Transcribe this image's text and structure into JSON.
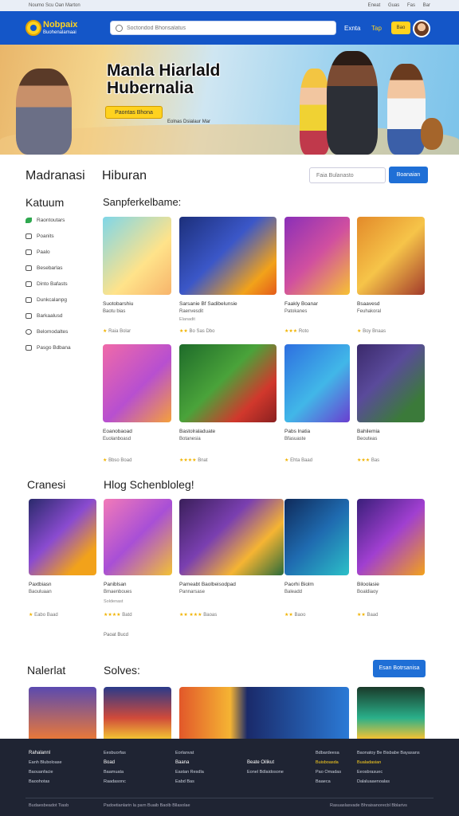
{
  "topbar": {
    "left": "Noumo Scu Oan Marton",
    "links": [
      "Eneat",
      "Guas",
      "Fas",
      "Bar"
    ]
  },
  "header": {
    "logo_title": "Nobpaix",
    "logo_sub": "Buohenalamaai",
    "search_placeholder": "Soctondod Bhonsalatus",
    "nav_link": "Exnta",
    "nav_link_active": "Tap",
    "button": "Bao"
  },
  "hero": {
    "title_line1": "Manla Hiarlald",
    "title_line2": "Hubernalia",
    "cta": "Paontas Bhona",
    "sub": "Eolnas Dsialaur Mar"
  },
  "filter_bar": {
    "left_title": "Madranasi",
    "title": "Hiburan",
    "input_placeholder": "Faia Bulanasto",
    "button": "Boanaian"
  },
  "sidebar": {
    "title": "Katuum",
    "items": [
      "Raontoutars",
      "Poanits",
      "Paalo",
      "Besebarlas",
      "Dinto Bafasts",
      "Dunkcalanpg",
      "Barkaalusd",
      "Belomodaltes",
      "Pasgo Bdbana"
    ]
  },
  "section1": {
    "title": "Sanpferkelbame:",
    "cards": [
      {
        "t1": "Suotobarshiu",
        "t2": "Baotu bias",
        "t3": "",
        "rate": "Raia Bolar",
        "stars": "★"
      },
      {
        "t1": "Sarsanie Bf Sadibelunsie",
        "t2": "Raenvesdit",
        "t3": "Elanadit",
        "rate": "Bo Sas Dbo",
        "stars": "★★"
      },
      {
        "t1": "Faakly Boanar",
        "t2": "Patokanes",
        "t3": "",
        "rate": "Roto",
        "stars": "★★★"
      },
      {
        "t1": "Bsaavesd",
        "t2": "Feuhakoral",
        "t3": "",
        "rate": "Boy Bnaas",
        "stars": "★"
      },
      {
        "t1": "Eoanobaoad",
        "t2": "Euolanboasd",
        "t3": "",
        "rate": "Bbso Boad",
        "stars": "★"
      },
      {
        "t1": "Bastolraladuate",
        "t2": "Botanesia",
        "t3": "",
        "rate": "Bnat",
        "stars": "★★★★"
      },
      {
        "t1": "Pabs lnatia",
        "t2": "Bfasuaste",
        "t3": "",
        "rate": "Ehta Baad",
        "stars": "★"
      },
      {
        "t1": "Bahilemia",
        "t2": "Beouteas",
        "t3": "",
        "rate": "Bas",
        "stars": "★★★"
      }
    ]
  },
  "section2": {
    "left_title": "Cranesi",
    "title": "Hlog Schenbloleg!",
    "cards": [
      {
        "t1": "Paxtbiasn",
        "t2": "Baouluaan",
        "t3": "",
        "rate": "Eabo Baad",
        "stars": "★"
      },
      {
        "t1": "Paniblsan",
        "t2": "Bmaenboues",
        "t3": "Soldenast",
        "rate": "Batd",
        "stars": "★★★★"
      },
      {
        "t1": "Pameabt Baolbeisodpad",
        "t2": "Pannarsase",
        "t3": "",
        "rate": "Baoas",
        "stars": "★★ ★★★"
      },
      {
        "t1": "Paorhi Biolm",
        "t2": "Baleadd",
        "t3": "",
        "rate": "Baoo",
        "stars": "★★"
      },
      {
        "t1": "Biloolasie",
        "t2": "Boaldiaoy",
        "t3": "",
        "rate": "Baad",
        "stars": "★★"
      }
    ],
    "more_link": "Paoat Bucd"
  },
  "section3": {
    "left_title": "Nalerlat",
    "title": "Solves:",
    "button": "Esan Botrsanisa"
  },
  "footer": {
    "col1": [
      "Rahalannl",
      "Eanh Bluboloase",
      "Baouanfacie",
      "Baoohotas"
    ],
    "col2": [
      "Eesbuorfas",
      "Boad",
      "Baamuata",
      "Raadasonc"
    ],
    "col3": [
      "Eorlanvat",
      "Baana",
      "Eastan Resdla",
      "Eabd Bas"
    ],
    "col4": [
      "Beate Oilikut",
      "Eonel Bdlaidosone"
    ],
    "col5": [
      "Bdbardeesa",
      "Buisboasda",
      "Pao Omadas",
      "Baaeca"
    ],
    "col6": [
      "Baonatoy Be Bisbabe Bayasans",
      "Bualadasian",
      "Eeosbrasuec",
      "Dalaluaaenoalas"
    ],
    "bottom_left": "Budaesbeadot Tiasb",
    "bottom_mid": "Padoetianlarin la parn Buaib Baolb Bllasolae",
    "bottom_right": "Rasuaslasvade Bhraisanorecbl Bblarivs"
  },
  "colors": {
    "brand_blue": "#1456c8",
    "accent_yellow": "#ffd21f",
    "button_blue": "#1f6fd6",
    "footer_bg": "#1f2433"
  }
}
